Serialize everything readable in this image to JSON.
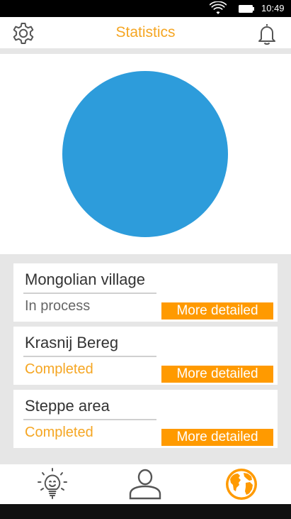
{
  "status_bar": {
    "time": "10:49"
  },
  "app_bar": {
    "title": "Statistics"
  },
  "chart": {
    "type": "pie",
    "color": "#2d9cdb"
  },
  "projects": [
    {
      "name": "Mongolian village",
      "status": "In process",
      "button": "More detailed"
    },
    {
      "name": "Krasnij Bereg",
      "status": "Completed",
      "button": "More detailed"
    },
    {
      "name": "Steppe area",
      "status": "Completed",
      "button": "More detailed"
    }
  ],
  "colors": {
    "accent": "#f5a623",
    "button": "#ff9a00",
    "chart": "#2d9cdb",
    "icon": "#555555"
  },
  "bottom_nav": {
    "items": [
      "lightbulb-icon",
      "profile-icon",
      "globe-icon"
    ],
    "active": "globe-icon"
  }
}
